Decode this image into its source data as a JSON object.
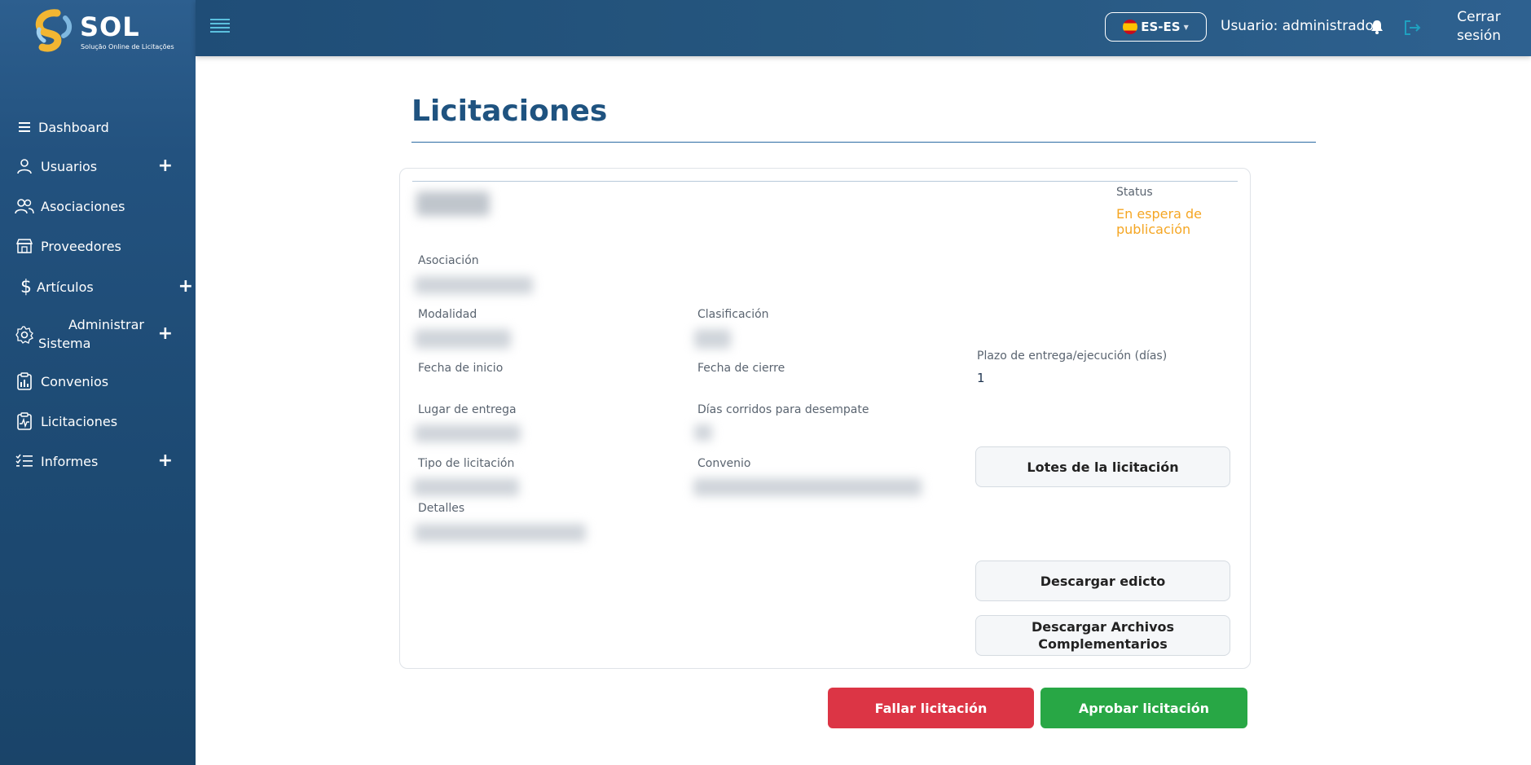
{
  "brand": {
    "name": "SOL",
    "tagline": "Solução Online de Licitações"
  },
  "topbar": {
    "language": "ES-ES",
    "user_label": "Usuario: administrador",
    "logout_line1": "Cerrar",
    "logout_line2": "sesión"
  },
  "sidebar": {
    "items": [
      {
        "label": "Dashboard",
        "icon": "menu-icon",
        "expandable": false
      },
      {
        "label": "Usuarios",
        "icon": "user-icon",
        "expandable": true
      },
      {
        "label": "Asociaciones",
        "icon": "users-icon",
        "expandable": false
      },
      {
        "label": "Proveedores",
        "icon": "store-icon",
        "expandable": false
      },
      {
        "label": "Artículos",
        "icon": "dollar-icon",
        "expandable": true
      },
      {
        "label_line1": "Administrar",
        "label_line2": "Sistema",
        "icon": "gear-icon",
        "expandable": true
      },
      {
        "label": "Convenios",
        "icon": "chart-clipboard-icon",
        "expandable": false
      },
      {
        "label": "Licitaciones",
        "icon": "clipboard-pulse-icon",
        "expandable": false
      },
      {
        "label": "Informes",
        "icon": "checklist-icon",
        "expandable": true
      }
    ]
  },
  "main": {
    "title": "Licitaciones",
    "status_label": "Status",
    "status_value": "En espera de publicación",
    "fields": {
      "asociacion": "Asociación",
      "modalidad": "Modalidad",
      "clasificacion": "Clasificación",
      "fecha_inicio": "Fecha de inicio",
      "fecha_cierre": "Fecha de cierre",
      "plazo": "Plazo de entrega/ejecución (días)",
      "plazo_value": "1",
      "lugar": "Lugar de entrega",
      "dias_corridos": "Días corridos para desempate",
      "tipo": "Tipo de licitación",
      "convenio": "Convenio",
      "detalles": "Detalles"
    },
    "buttons": {
      "lotes": "Lotes de la licitación",
      "edicto": "Descargar edicto",
      "complementarios_line1": "Descargar Archivos",
      "complementarios_line2": "Complementarios",
      "fallar": "Fallar licitación",
      "aprobar": "Aprobar licitación"
    }
  },
  "colors": {
    "accent": "#1f5380",
    "status": "#f5a623",
    "danger": "#dc3545",
    "success": "#28a745"
  }
}
